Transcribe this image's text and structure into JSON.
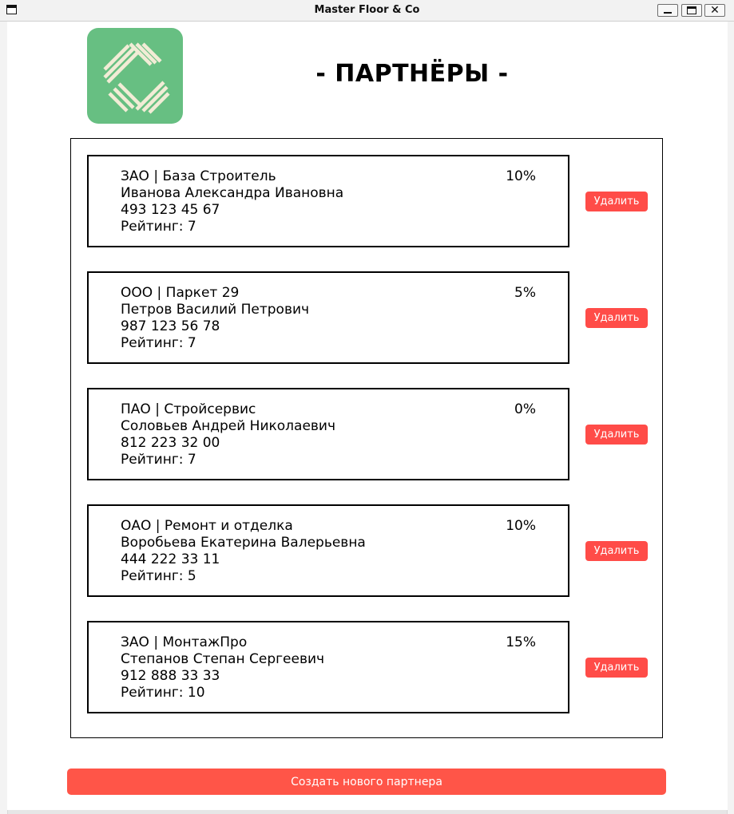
{
  "window": {
    "title": "Master Floor & Co"
  },
  "header": {
    "logo_icon": "parquet-logo-icon",
    "title": "- ПАРТНЁРЫ -"
  },
  "colors": {
    "logo_bg": "#67bf82",
    "accent_button": "#ff4c48"
  },
  "partners": [
    {
      "type_name": "ЗАО | База Строитель",
      "director": "Иванова Александра Ивановна",
      "phone": "493 123 45 67",
      "rating": "Рейтинг: 7",
      "discount": "10%",
      "delete_label": "Удалить"
    },
    {
      "type_name": "ООО | Паркет 29",
      "director": "Петров Василий Петрович",
      "phone": "987 123 56 78",
      "rating": "Рейтинг: 7",
      "discount": "5%",
      "delete_label": "Удалить"
    },
    {
      "type_name": "ПАО | Стройсервис",
      "director": "Соловьев Андрей Николаевич",
      "phone": "812 223 32 00",
      "rating": "Рейтинг: 7",
      "discount": "0%",
      "delete_label": "Удалить"
    },
    {
      "type_name": "ОАО | Ремонт и отделка",
      "director": "Воробьева Екатерина Валерьевна",
      "phone": "444 222 33 11",
      "rating": "Рейтинг: 5",
      "discount": "10%",
      "delete_label": "Удалить"
    },
    {
      "type_name": "ЗАО | МонтажПро",
      "director": "Степанов Степан Сергеевич",
      "phone": "912 888 33 33",
      "rating": "Рейтинг: 10",
      "discount": "15%",
      "delete_label": "Удалить"
    }
  ],
  "footer": {
    "create_label": "Создать нового партнера"
  }
}
